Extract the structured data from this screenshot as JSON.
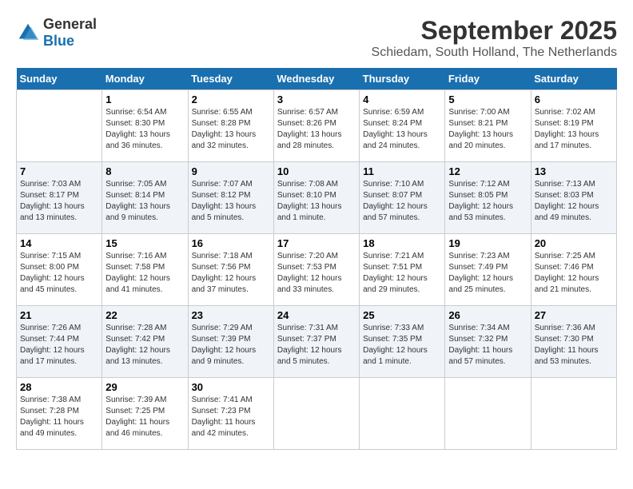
{
  "header": {
    "logo_general": "General",
    "logo_blue": "Blue",
    "month_title": "September 2025",
    "location": "Schiedam, South Holland, The Netherlands"
  },
  "weekdays": [
    "Sunday",
    "Monday",
    "Tuesday",
    "Wednesday",
    "Thursday",
    "Friday",
    "Saturday"
  ],
  "weeks": [
    [
      {
        "day": "",
        "sunrise": "",
        "sunset": "",
        "daylight": ""
      },
      {
        "day": "1",
        "sunrise": "Sunrise: 6:54 AM",
        "sunset": "Sunset: 8:30 PM",
        "daylight": "Daylight: 13 hours and 36 minutes."
      },
      {
        "day": "2",
        "sunrise": "Sunrise: 6:55 AM",
        "sunset": "Sunset: 8:28 PM",
        "daylight": "Daylight: 13 hours and 32 minutes."
      },
      {
        "day": "3",
        "sunrise": "Sunrise: 6:57 AM",
        "sunset": "Sunset: 8:26 PM",
        "daylight": "Daylight: 13 hours and 28 minutes."
      },
      {
        "day": "4",
        "sunrise": "Sunrise: 6:59 AM",
        "sunset": "Sunset: 8:24 PM",
        "daylight": "Daylight: 13 hours and 24 minutes."
      },
      {
        "day": "5",
        "sunrise": "Sunrise: 7:00 AM",
        "sunset": "Sunset: 8:21 PM",
        "daylight": "Daylight: 13 hours and 20 minutes."
      },
      {
        "day": "6",
        "sunrise": "Sunrise: 7:02 AM",
        "sunset": "Sunset: 8:19 PM",
        "daylight": "Daylight: 13 hours and 17 minutes."
      }
    ],
    [
      {
        "day": "7",
        "sunrise": "Sunrise: 7:03 AM",
        "sunset": "Sunset: 8:17 PM",
        "daylight": "Daylight: 13 hours and 13 minutes."
      },
      {
        "day": "8",
        "sunrise": "Sunrise: 7:05 AM",
        "sunset": "Sunset: 8:14 PM",
        "daylight": "Daylight: 13 hours and 9 minutes."
      },
      {
        "day": "9",
        "sunrise": "Sunrise: 7:07 AM",
        "sunset": "Sunset: 8:12 PM",
        "daylight": "Daylight: 13 hours and 5 minutes."
      },
      {
        "day": "10",
        "sunrise": "Sunrise: 7:08 AM",
        "sunset": "Sunset: 8:10 PM",
        "daylight": "Daylight: 13 hours and 1 minute."
      },
      {
        "day": "11",
        "sunrise": "Sunrise: 7:10 AM",
        "sunset": "Sunset: 8:07 PM",
        "daylight": "Daylight: 12 hours and 57 minutes."
      },
      {
        "day": "12",
        "sunrise": "Sunrise: 7:12 AM",
        "sunset": "Sunset: 8:05 PM",
        "daylight": "Daylight: 12 hours and 53 minutes."
      },
      {
        "day": "13",
        "sunrise": "Sunrise: 7:13 AM",
        "sunset": "Sunset: 8:03 PM",
        "daylight": "Daylight: 12 hours and 49 minutes."
      }
    ],
    [
      {
        "day": "14",
        "sunrise": "Sunrise: 7:15 AM",
        "sunset": "Sunset: 8:00 PM",
        "daylight": "Daylight: 12 hours and 45 minutes."
      },
      {
        "day": "15",
        "sunrise": "Sunrise: 7:16 AM",
        "sunset": "Sunset: 7:58 PM",
        "daylight": "Daylight: 12 hours and 41 minutes."
      },
      {
        "day": "16",
        "sunrise": "Sunrise: 7:18 AM",
        "sunset": "Sunset: 7:56 PM",
        "daylight": "Daylight: 12 hours and 37 minutes."
      },
      {
        "day": "17",
        "sunrise": "Sunrise: 7:20 AM",
        "sunset": "Sunset: 7:53 PM",
        "daylight": "Daylight: 12 hours and 33 minutes."
      },
      {
        "day": "18",
        "sunrise": "Sunrise: 7:21 AM",
        "sunset": "Sunset: 7:51 PM",
        "daylight": "Daylight: 12 hours and 29 minutes."
      },
      {
        "day": "19",
        "sunrise": "Sunrise: 7:23 AM",
        "sunset": "Sunset: 7:49 PM",
        "daylight": "Daylight: 12 hours and 25 minutes."
      },
      {
        "day": "20",
        "sunrise": "Sunrise: 7:25 AM",
        "sunset": "Sunset: 7:46 PM",
        "daylight": "Daylight: 12 hours and 21 minutes."
      }
    ],
    [
      {
        "day": "21",
        "sunrise": "Sunrise: 7:26 AM",
        "sunset": "Sunset: 7:44 PM",
        "daylight": "Daylight: 12 hours and 17 minutes."
      },
      {
        "day": "22",
        "sunrise": "Sunrise: 7:28 AM",
        "sunset": "Sunset: 7:42 PM",
        "daylight": "Daylight: 12 hours and 13 minutes."
      },
      {
        "day": "23",
        "sunrise": "Sunrise: 7:29 AM",
        "sunset": "Sunset: 7:39 PM",
        "daylight": "Daylight: 12 hours and 9 minutes."
      },
      {
        "day": "24",
        "sunrise": "Sunrise: 7:31 AM",
        "sunset": "Sunset: 7:37 PM",
        "daylight": "Daylight: 12 hours and 5 minutes."
      },
      {
        "day": "25",
        "sunrise": "Sunrise: 7:33 AM",
        "sunset": "Sunset: 7:35 PM",
        "daylight": "Daylight: 12 hours and 1 minute."
      },
      {
        "day": "26",
        "sunrise": "Sunrise: 7:34 AM",
        "sunset": "Sunset: 7:32 PM",
        "daylight": "Daylight: 11 hours and 57 minutes."
      },
      {
        "day": "27",
        "sunrise": "Sunrise: 7:36 AM",
        "sunset": "Sunset: 7:30 PM",
        "daylight": "Daylight: 11 hours and 53 minutes."
      }
    ],
    [
      {
        "day": "28",
        "sunrise": "Sunrise: 7:38 AM",
        "sunset": "Sunset: 7:28 PM",
        "daylight": "Daylight: 11 hours and 49 minutes."
      },
      {
        "day": "29",
        "sunrise": "Sunrise: 7:39 AM",
        "sunset": "Sunset: 7:25 PM",
        "daylight": "Daylight: 11 hours and 46 minutes."
      },
      {
        "day": "30",
        "sunrise": "Sunrise: 7:41 AM",
        "sunset": "Sunset: 7:23 PM",
        "daylight": "Daylight: 11 hours and 42 minutes."
      },
      {
        "day": "",
        "sunrise": "",
        "sunset": "",
        "daylight": ""
      },
      {
        "day": "",
        "sunrise": "",
        "sunset": "",
        "daylight": ""
      },
      {
        "day": "",
        "sunrise": "",
        "sunset": "",
        "daylight": ""
      },
      {
        "day": "",
        "sunrise": "",
        "sunset": "",
        "daylight": ""
      }
    ]
  ]
}
